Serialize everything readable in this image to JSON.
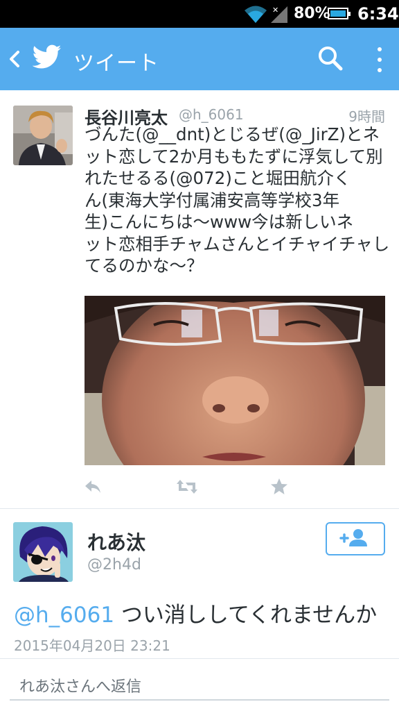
{
  "status_bar": {
    "battery_percent": "80%",
    "time": "6:34",
    "icons": [
      "wifi-icon",
      "signal-icon",
      "battery-icon"
    ]
  },
  "action_bar": {
    "title": "ツイート",
    "icons": [
      "back-arrow-icon",
      "twitter-bird-icon",
      "search-icon",
      "overflow-menu-icon"
    ],
    "color": "#55acee"
  },
  "tweet": {
    "author_name": "長谷川亮太",
    "author_handle": "@h_6061",
    "relative_time": "9時間",
    "text_lines": [
      "づんた(@__dnt)とじるぜ(@_JirZ)とネ",
      "ット恋して2か月ももたずに浮気して別",
      "れたせるる(@072)こと堀田航介く",
      "ん(東海大学付属浦安高等学校3年",
      "生)こんにちは〜www今は新しいネ",
      "ット恋相手チャムさんとイチャイチャし",
      "てるのかな〜？"
    ],
    "actions": [
      "reply-icon",
      "retweet-icon",
      "favorite-icon"
    ]
  },
  "reply_tweet": {
    "author_name": "れあ汰",
    "author_handle": "@2h4d",
    "mention": "@h_6061",
    "text": " つい消ししてくれませんか",
    "timestamp": "2015年04月20日 23:21",
    "follow_icon": "add-user-icon"
  },
  "reply_box": {
    "placeholder": "れあ汰さんへ返信"
  }
}
